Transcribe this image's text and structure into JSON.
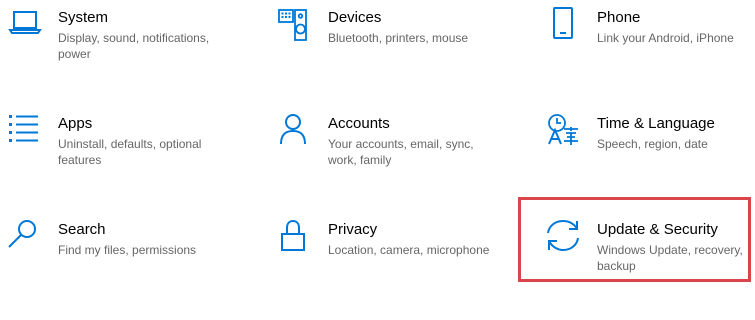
{
  "accent_color": "#0078d7",
  "highlight_color": "#d9454b",
  "tiles": [
    {
      "title": "System",
      "description": "Display, sound, notifications, power",
      "icon": "laptop-icon"
    },
    {
      "title": "Devices",
      "description": "Bluetooth, printers, mouse",
      "icon": "keyboard-speaker-icon"
    },
    {
      "title": "Phone",
      "description": "Link your Android, iPhone",
      "icon": "phone-icon"
    },
    {
      "title": "Apps",
      "description": "Uninstall, defaults, optional features",
      "icon": "apps-list-icon"
    },
    {
      "title": "Accounts",
      "description": "Your accounts, email, sync, work, family",
      "icon": "person-icon"
    },
    {
      "title": "Time & Language",
      "description": "Speech, region, date",
      "icon": "time-language-icon"
    },
    {
      "title": "Search",
      "description": "Find my files, permissions",
      "icon": "search-icon"
    },
    {
      "title": "Privacy",
      "description": "Location, camera, microphone",
      "icon": "lock-icon"
    },
    {
      "title": "Update & Security",
      "description": "Windows Update, recovery, backup",
      "icon": "sync-arrows-icon"
    }
  ]
}
